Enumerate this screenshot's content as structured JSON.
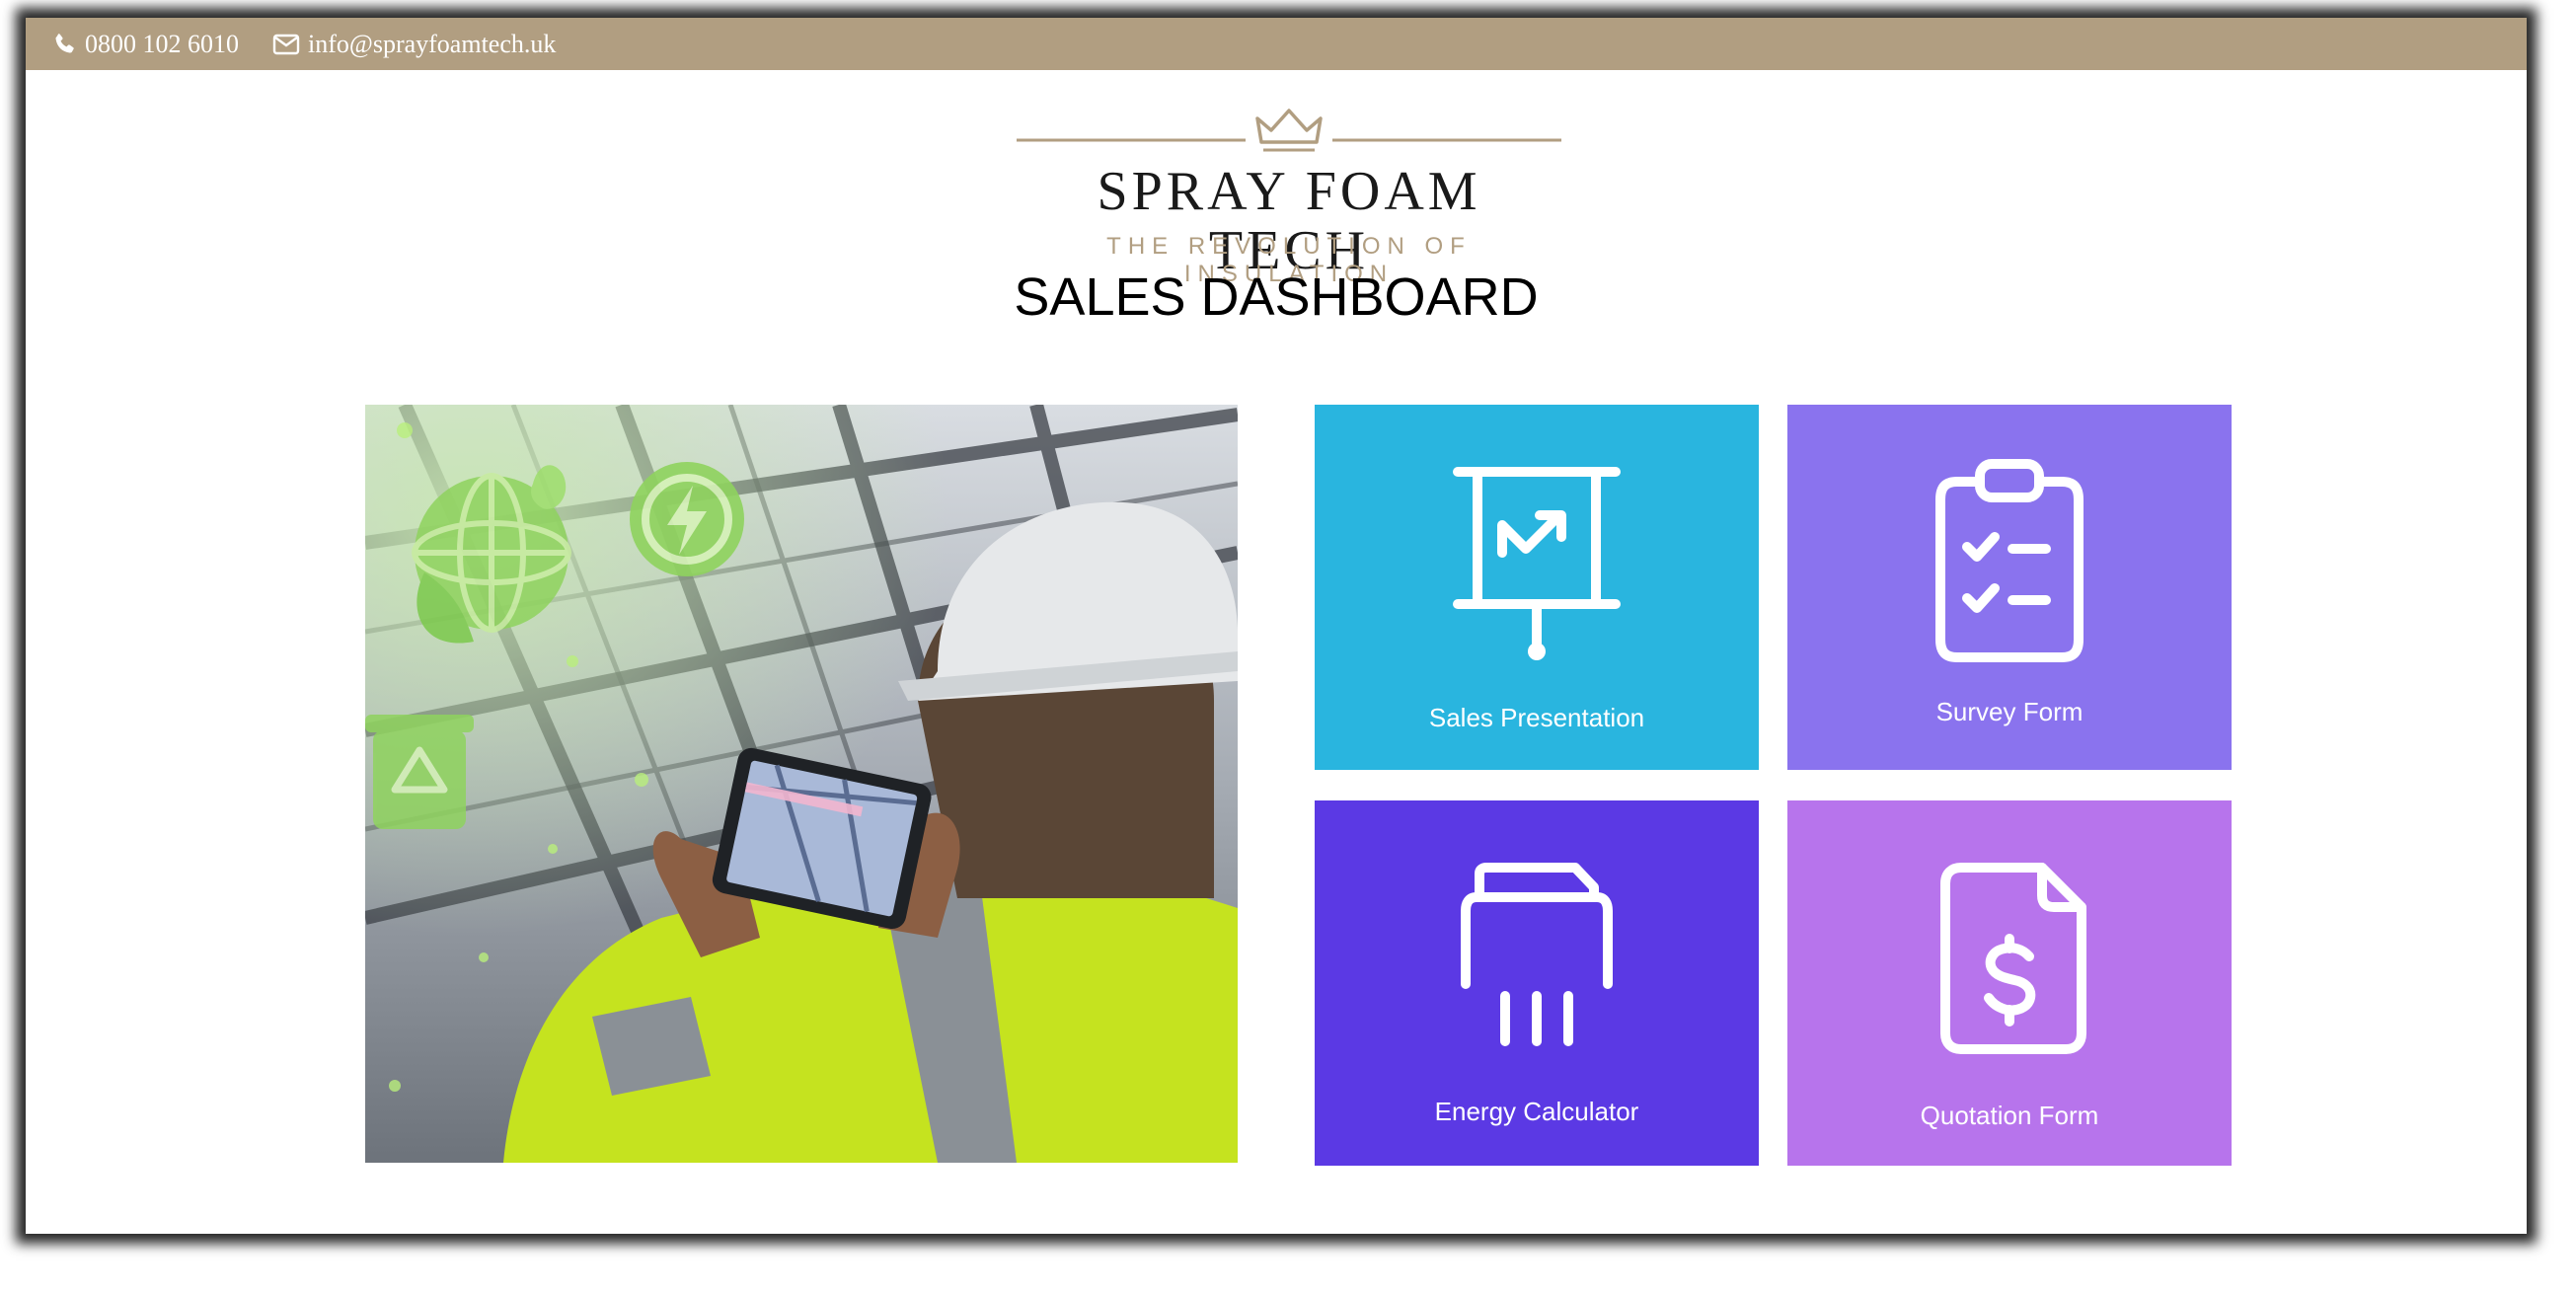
{
  "topbar": {
    "phone": "0800 102 6010",
    "email": "info@sprayfoamtech.uk",
    "background": "#b19e81"
  },
  "logo": {
    "name": "SPRAY FOAM TECH",
    "tagline": "THE REVOLUTION OF INSULATION",
    "accent": "#b19e81",
    "icon": "crown-icon"
  },
  "page": {
    "title": "SALES DASHBOARD"
  },
  "hero": {
    "icons": [
      "globe-leaf-icon",
      "energy-icon",
      "recycle-bin-icon"
    ]
  },
  "tiles": [
    {
      "label": "Sales Presentation",
      "icon": "presentation-board-icon",
      "color": "#29b5df"
    },
    {
      "label": "Survey Form",
      "icon": "clipboard-checklist-icon",
      "color": "#8a73ee"
    },
    {
      "label": "Energy Calculator",
      "icon": "shredder-icon",
      "color": "#5b39e4"
    },
    {
      "label": "Quotation Form",
      "icon": "dollar-document-icon",
      "color": "#b774ec"
    }
  ]
}
